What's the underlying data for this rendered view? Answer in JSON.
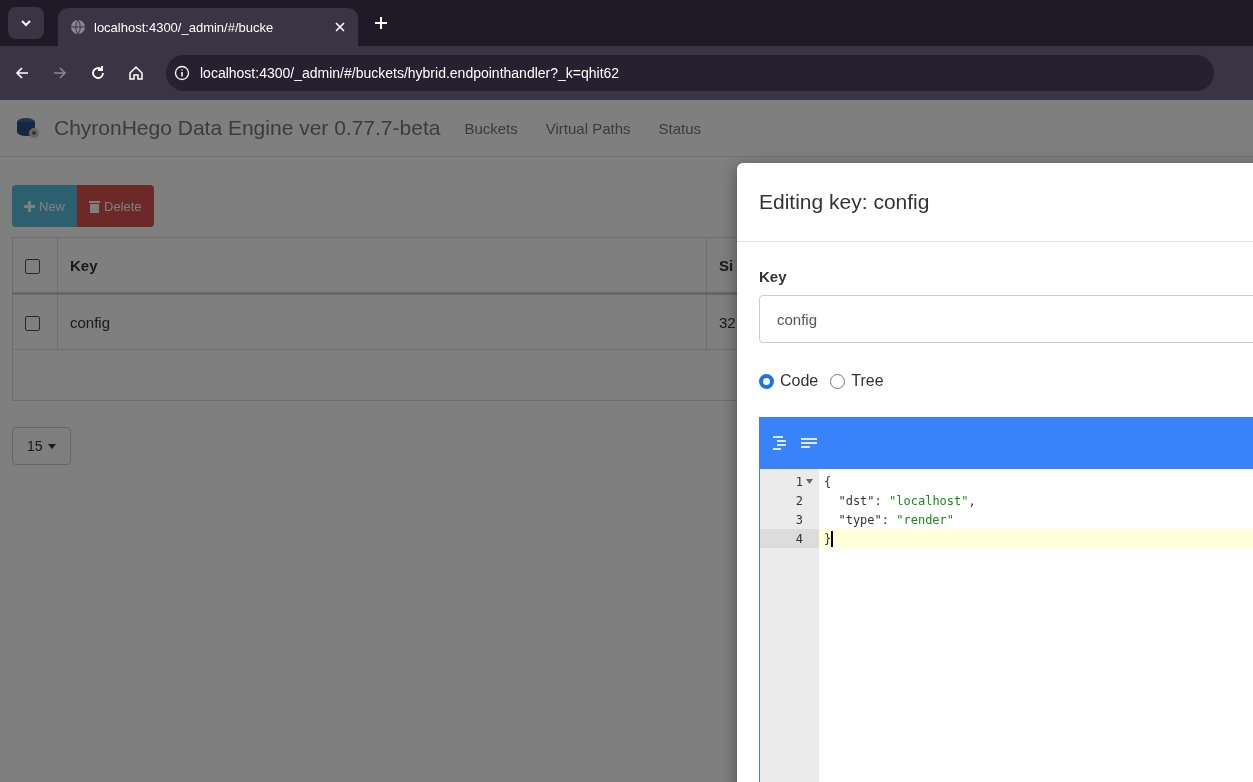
{
  "browser": {
    "tab_title": "localhost:4300/_admin/#/bucke",
    "url": "localhost:4300/_admin/#/buckets/hybrid.endpointhandler?_k=qhit62"
  },
  "navbar": {
    "brand": "ChyronHego Data Engine ver 0.77.7-beta",
    "links": [
      "Buckets",
      "Virtual Paths",
      "Status"
    ]
  },
  "toolbar": {
    "buttons": [
      {
        "kind": "new",
        "label": "New"
      },
      {
        "kind": "delete",
        "label": "Delete"
      }
    ]
  },
  "table": {
    "columns": [
      "Key",
      "Si"
    ],
    "header_checked": false,
    "rows": [
      {
        "checked": false,
        "cells": [
          "config",
          "32"
        ]
      }
    ]
  },
  "page_size": "15",
  "modal": {
    "title": "Editing key: config",
    "key_label": "Key",
    "key_value": "config",
    "modes": [
      {
        "label": "Code",
        "selected": true
      },
      {
        "label": "Tree",
        "selected": false
      }
    ],
    "code_lines": [
      {
        "number": "1",
        "foldable": true,
        "active": false,
        "tokens": [
          {
            "kind": "punct",
            "text": "{"
          }
        ]
      },
      {
        "number": "2",
        "foldable": false,
        "active": false,
        "tokens": [
          {
            "kind": "key",
            "text": "  \"dst\""
          },
          {
            "kind": "punct",
            "text": ": "
          },
          {
            "kind": "string",
            "text": "\"localhost\""
          },
          {
            "kind": "punct",
            "text": ","
          }
        ]
      },
      {
        "number": "3",
        "foldable": false,
        "active": false,
        "tokens": [
          {
            "kind": "key",
            "text": "  \"type\""
          },
          {
            "kind": "punct",
            "text": ": "
          },
          {
            "kind": "string",
            "text": "\"render\""
          }
        ]
      },
      {
        "number": "4",
        "foldable": false,
        "active": true,
        "tokens": [
          {
            "kind": "punct",
            "text": "}"
          }
        ]
      }
    ]
  }
}
